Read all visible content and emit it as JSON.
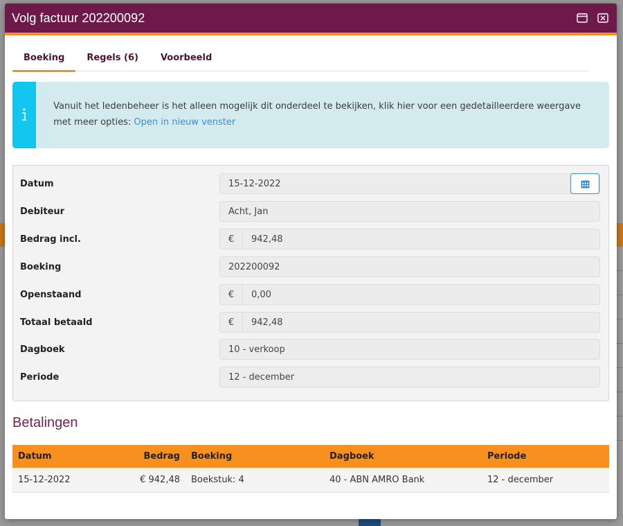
{
  "window": {
    "title": "Volg factuur 202200092"
  },
  "tabs": [
    {
      "label": "Boeking"
    },
    {
      "label": "Regels (6)"
    },
    {
      "label": "Voorbeeld"
    }
  ],
  "alert": {
    "icon": "info-icon",
    "text": "Vanuit het ledenbeheer is het alleen mogelijk dit onderdeel te bekijken, klik hier voor een gedetailleerdere weergave met meer opties: ",
    "link": "Open in nieuw venster"
  },
  "form": {
    "datum": {
      "label": "Datum",
      "value": "15-12-2022"
    },
    "debiteur": {
      "label": "Debiteur",
      "value": "Acht, Jan"
    },
    "bedrag": {
      "label": "Bedrag incl.",
      "currency": "€",
      "value": "942,48"
    },
    "boeking": {
      "label": "Boeking",
      "value": "202200092"
    },
    "openstaand": {
      "label": "Openstaand",
      "currency": "€",
      "value": "0,00"
    },
    "totaal": {
      "label": "Totaal betaald",
      "currency": "€",
      "value": "942,48"
    },
    "dagboek": {
      "label": "Dagboek",
      "value": "10 - verkoop"
    },
    "periode": {
      "label": "Periode",
      "value": "12 - december"
    }
  },
  "payments": {
    "title": "Betalingen",
    "columns": {
      "datum": "Datum",
      "bedrag": "Bedrag",
      "boeking": "Boeking",
      "dagboek": "Dagboek",
      "periode": "Periode"
    },
    "rows": [
      {
        "datum": "15-12-2022",
        "bedrag": "€ 942,48",
        "boeking": "Boekstuk: 4",
        "dagboek": "40 - ABN AMRO Bank",
        "periode": "12 - december"
      }
    ]
  },
  "colors": {
    "titlebar": "#6d1a4a",
    "accent": "#f7901e",
    "info": "#13c6f0",
    "link": "#3a8ed8"
  }
}
